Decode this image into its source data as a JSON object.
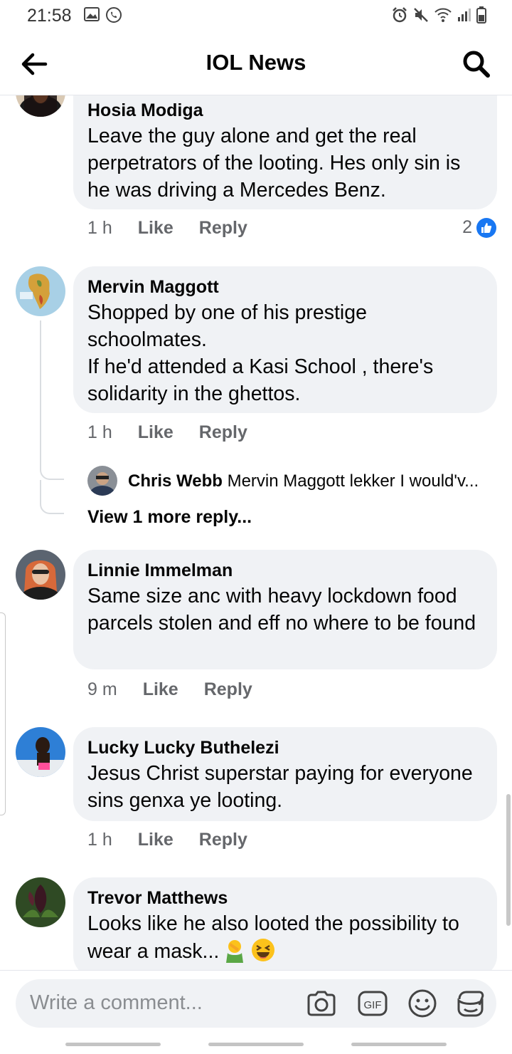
{
  "status_bar": {
    "time": "21:58",
    "left_icons": [
      "gallery-icon",
      "whatsapp-icon"
    ],
    "right_icons": [
      "alarm-icon",
      "mute-icon",
      "wifi-icon",
      "signal-icon",
      "battery-icon"
    ]
  },
  "header": {
    "title": "IOL News",
    "back_icon": "back-arrow-icon",
    "search_icon": "search-icon"
  },
  "comments": [
    {
      "author": "Hosia Modiga",
      "text": "Leave the guy alone and get the real perpetrators of the looting. Hes only sin is he was driving a Mercedes Benz.",
      "time": "1 h",
      "like_label": "Like",
      "reply_label": "Reply",
      "reaction_count": "2"
    },
    {
      "author": "Mervin Maggott",
      "text": "Shopped by one of his prestige schoolmates.\nIf he'd attended a Kasi School , there's solidarity in the ghettos.",
      "time": "1 h",
      "like_label": "Like",
      "reply_label": "Reply",
      "reply_preview": {
        "author": "Chris Webb",
        "text": "Mervin Maggott lekker I would'v..."
      },
      "view_more": "View 1 more reply..."
    },
    {
      "author": "Linnie Immelman",
      "text": "Same size anc with heavy lockdown food parcels stolen and eff no where to be found",
      "time": "9 m",
      "like_label": "Like",
      "reply_label": "Reply"
    },
    {
      "author": "Lucky Lucky Buthelezi",
      "text": "Jesus Christ superstar paying for everyone sins genxa      ye looting.",
      "time": "1 h",
      "like_label": "Like",
      "reply_label": "Reply"
    },
    {
      "author": "Trevor Matthews",
      "text": "Looks like he also looted the possibility to wear a mask...",
      "emojis": [
        "facepalm-emoji",
        "laughing-emoji"
      ]
    }
  ],
  "composer": {
    "placeholder": "Write a comment...",
    "icons": [
      "camera-icon",
      "gif-icon",
      "emoji-icon",
      "sticker-icon"
    ]
  },
  "colors": {
    "bubble": "#f0f2f5",
    "meta_text": "#65676b",
    "like_blue": "#1877f2"
  }
}
